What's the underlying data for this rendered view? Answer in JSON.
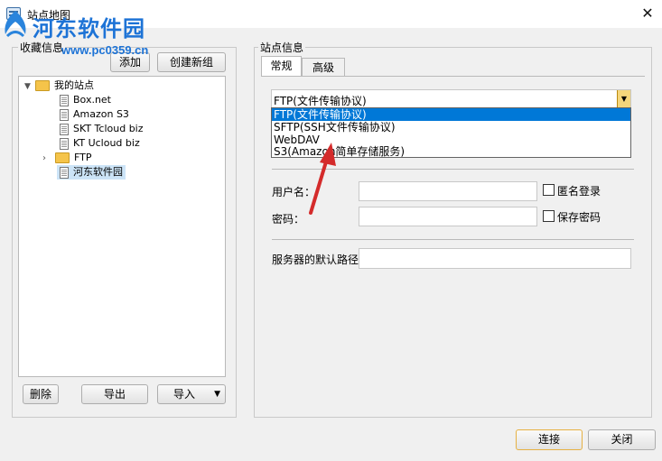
{
  "window": {
    "title": "站点地图",
    "close_glyph": "✕"
  },
  "watermark": {
    "text": "河东软件园",
    "url": "www.pc0359.cn"
  },
  "left_panel": {
    "group_label": "收藏信息",
    "add_label": "添加",
    "new_group_label": "创建新组",
    "tree": {
      "root": "我的站点",
      "items": [
        "Box.net",
        "Amazon S3",
        "SKT Tcloud biz",
        "KT Ucloud biz"
      ],
      "ftp_folder": "FTP",
      "selected": "河东软件园"
    },
    "delete_label": "删除",
    "export_label": "导出",
    "import_label": "导入"
  },
  "right_panel": {
    "group_label": "站点信息",
    "tabs": [
      "常规",
      "高级"
    ],
    "protocol": {
      "selected": "FTP(文件传输协议)",
      "options": [
        "FTP(文件传输协议)",
        "SFTP(SSH文件传输协议)",
        "WebDAV",
        "S3(Amazon简单存储服务)"
      ]
    },
    "username_label": "用户名：",
    "anonymous_label": "匿名登录",
    "password_label": "密码：",
    "save_password_label": "保存密码",
    "default_path_label": "服务器的默认路径"
  },
  "footer": {
    "connect_label": "连接",
    "close_label": "关闭"
  },
  "colors": {
    "selection": "#0078d7",
    "arrow": "#d42b2b",
    "watermark": "#1d73d6"
  }
}
